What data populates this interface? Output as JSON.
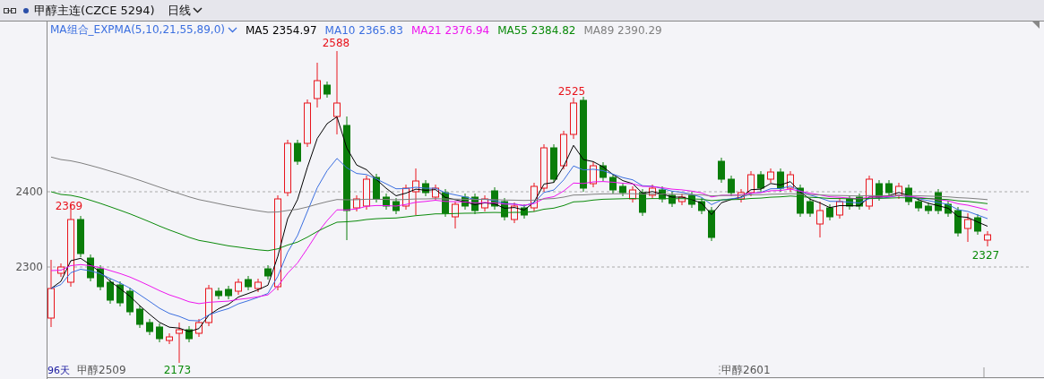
{
  "header": {
    "symbol": "甲醇主连(CZCE 5294)",
    "period": "日线"
  },
  "legend": {
    "indicator": "MA组合_EXPMA(5,10,21,55,89,0)",
    "items": [
      {
        "label": "MA5 2354.97",
        "color": "#000000"
      },
      {
        "label": "MA10 2365.83",
        "color": "#3b6fe0"
      },
      {
        "label": "MA21 2376.94",
        "color": "#ee14ee"
      },
      {
        "label": "MA55 2384.82",
        "color": "#0a8a0a"
      },
      {
        "label": "MA89 2390.29",
        "color": "#808080"
      }
    ]
  },
  "y_axis": {
    "labels": [
      "2400",
      "2300"
    ]
  },
  "price_labels": [
    {
      "text": "2369",
      "color": "#e8141c"
    },
    {
      "text": "2588",
      "color": "#e8141c"
    },
    {
      "text": "2525",
      "color": "#e8141c"
    },
    {
      "text": "2173",
      "color": "#0a8a0a"
    },
    {
      "text": "2327",
      "color": "#0a8a0a"
    }
  ],
  "x_axis": {
    "day_count": "96天",
    "contracts": [
      "甲醇2509",
      "甲醇2601"
    ]
  }
}
